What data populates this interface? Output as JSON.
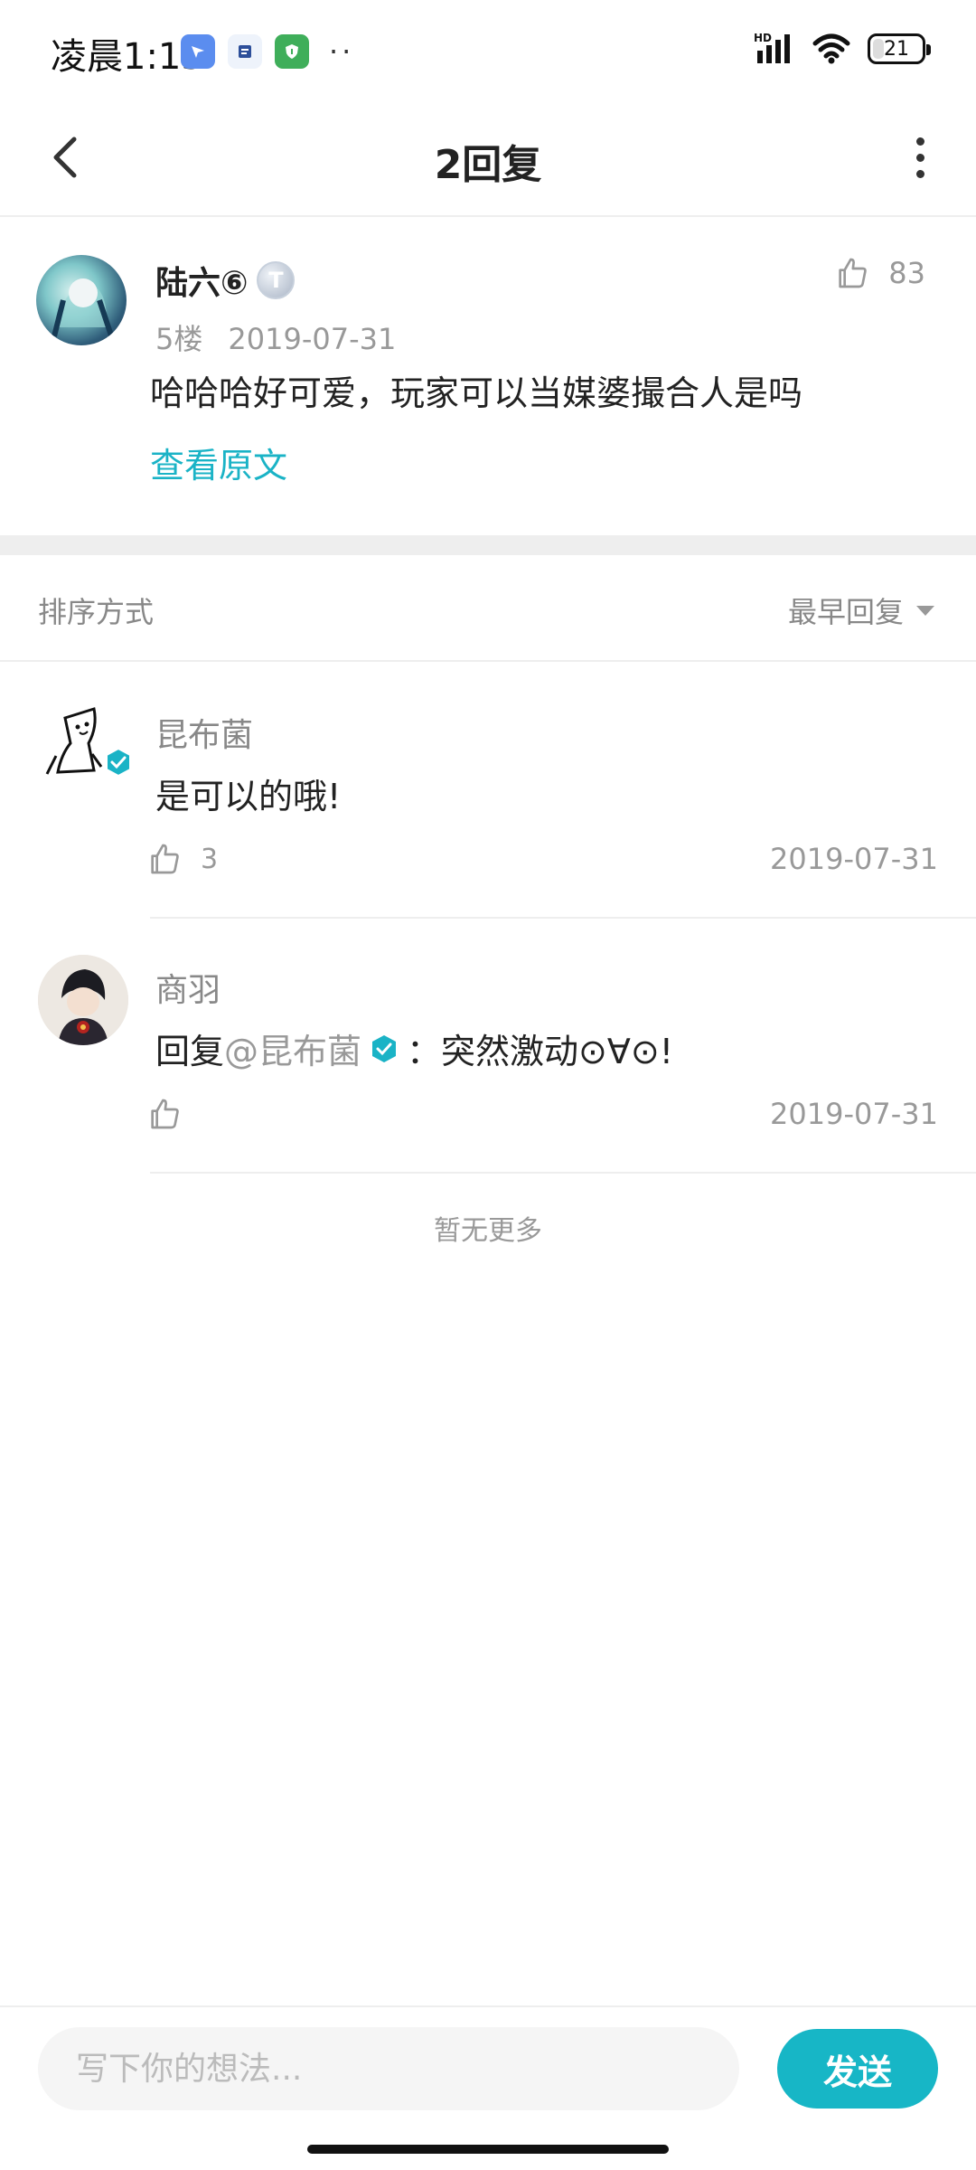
{
  "status_bar": {
    "time": "凌晨1:15",
    "battery": "21",
    "dots": "··",
    "apps": [
      "bird-app-icon",
      "news-app-icon",
      "shield-app-icon"
    ],
    "signal_label": "HD"
  },
  "nav": {
    "title": "2回复"
  },
  "post": {
    "author": "陆六⑥",
    "level_badge": "T",
    "floor": "5楼",
    "date": "2019-07-31",
    "text": "哈哈哈好可爱，玩家可以当媒婆撮合人是吗",
    "view_original": "查看原文",
    "likes": "83"
  },
  "sort": {
    "label": "排序方式",
    "selected": "最早回复"
  },
  "replies": [
    {
      "author": "昆布菌",
      "text": "是可以的哦!",
      "likes": "3",
      "date": "2019-07-31"
    },
    {
      "author": "商羽",
      "reply_prefix": "回复",
      "mention": "@昆布菌",
      "text": "：突然激动⊙∀⊙!",
      "likes": "",
      "date": "2019-07-31"
    }
  ],
  "no_more": "暂无更多",
  "composer": {
    "placeholder": "写下你的想法...",
    "send_label": "发送"
  },
  "colors": {
    "accent": "#17b6c6",
    "link": "#1ab3c6",
    "muted": "#999999",
    "divider": "#eeeeee"
  }
}
